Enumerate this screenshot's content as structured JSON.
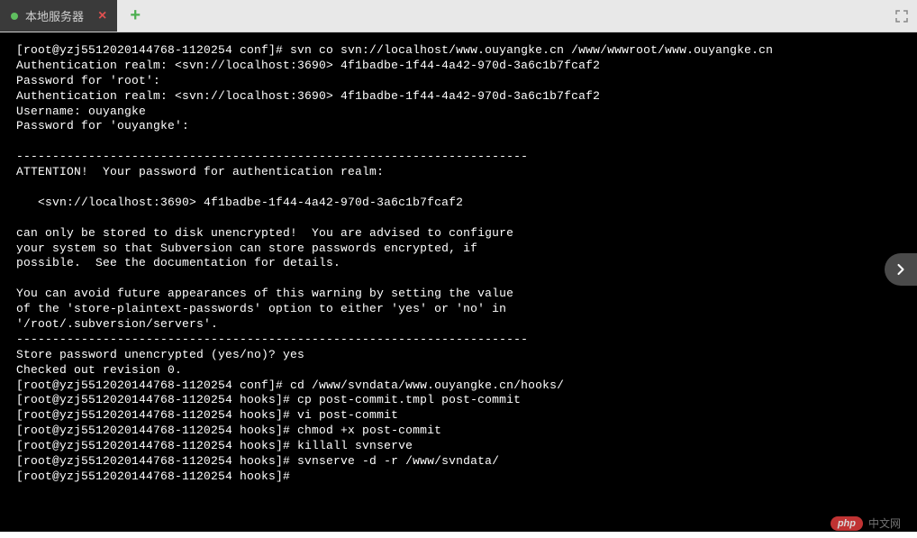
{
  "tab": {
    "title": "本地服务器",
    "close_symbol": "×",
    "add_symbol": "+"
  },
  "terminal": {
    "lines": [
      "[root@yzj5512020144768-1120254 conf]# svn co svn://localhost/www.ouyangke.cn /www/wwwroot/www.ouyangke.cn",
      "Authentication realm: <svn://localhost:3690> 4f1badbe-1f44-4a42-970d-3a6c1b7fcaf2",
      "Password for 'root':",
      "Authentication realm: <svn://localhost:3690> 4f1badbe-1f44-4a42-970d-3a6c1b7fcaf2",
      "Username: ouyangke",
      "Password for 'ouyangke':",
      "",
      "-----------------------------------------------------------------------",
      "ATTENTION!  Your password for authentication realm:",
      "",
      "   <svn://localhost:3690> 4f1badbe-1f44-4a42-970d-3a6c1b7fcaf2",
      "",
      "can only be stored to disk unencrypted!  You are advised to configure",
      "your system so that Subversion can store passwords encrypted, if",
      "possible.  See the documentation for details.",
      "",
      "You can avoid future appearances of this warning by setting the value",
      "of the 'store-plaintext-passwords' option to either 'yes' or 'no' in",
      "'/root/.subversion/servers'.",
      "-----------------------------------------------------------------------",
      "Store password unencrypted (yes/no)? yes",
      "Checked out revision 0.",
      "[root@yzj5512020144768-1120254 conf]# cd /www/svndata/www.ouyangke.cn/hooks/",
      "[root@yzj5512020144768-1120254 hooks]# cp post-commit.tmpl post-commit",
      "[root@yzj5512020144768-1120254 hooks]# vi post-commit",
      "[root@yzj5512020144768-1120254 hooks]# chmod +x post-commit",
      "[root@yzj5512020144768-1120254 hooks]# killall svnserve",
      "[root@yzj5512020144768-1120254 hooks]# svnserve -d -r /www/svndata/",
      "[root@yzj5512020144768-1120254 hooks]#"
    ]
  },
  "watermark": {
    "logo": "php",
    "text": "中文网"
  }
}
